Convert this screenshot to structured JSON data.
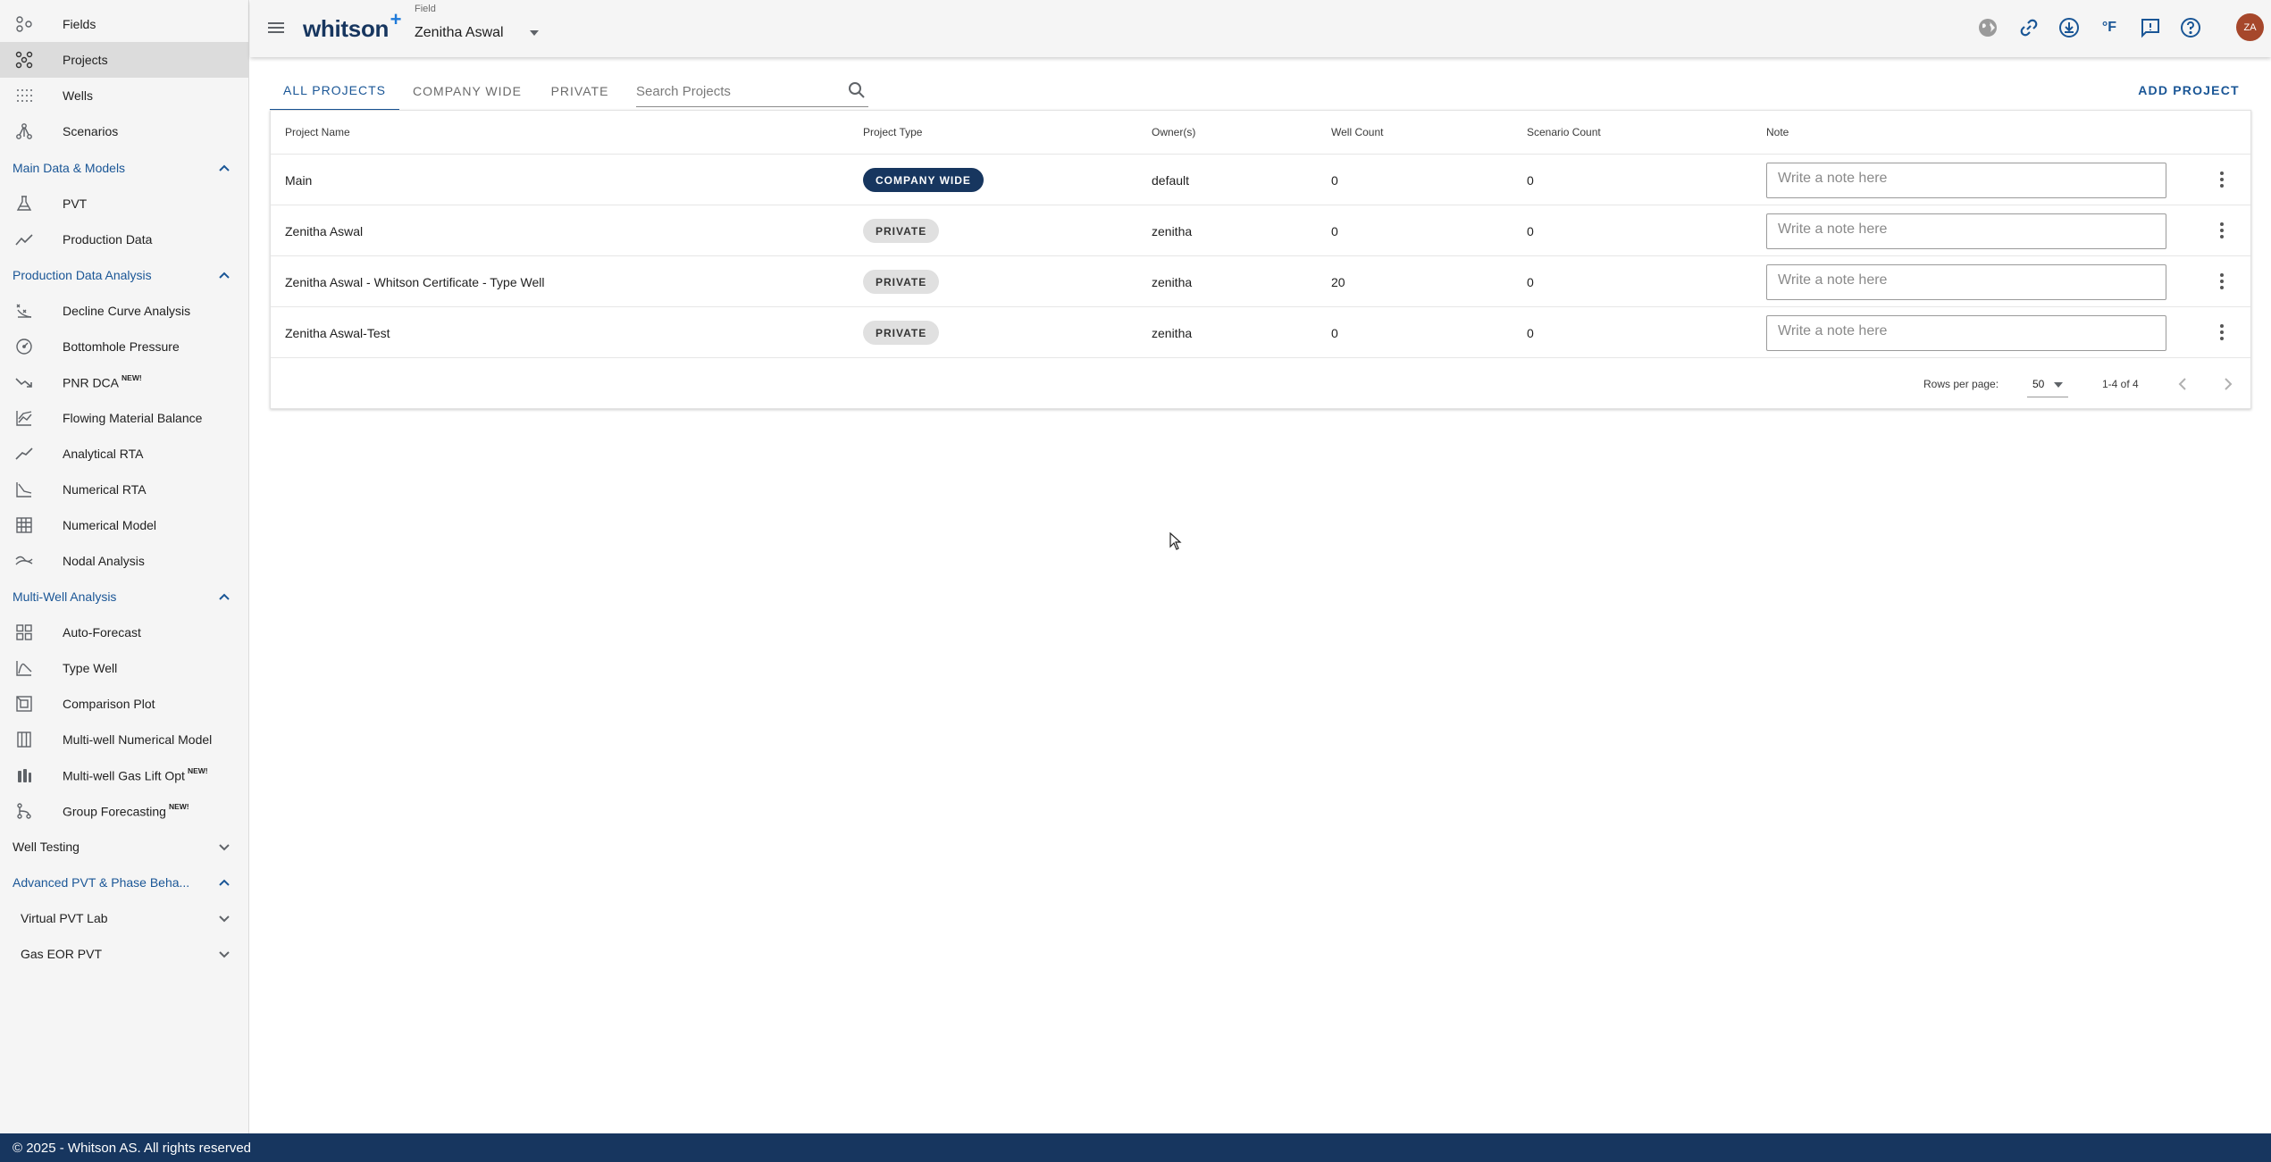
{
  "sidebar": {
    "top_items": [
      {
        "label": "Fields",
        "icon": "fields-icon"
      },
      {
        "label": "Projects",
        "icon": "projects-icon"
      },
      {
        "label": "Wells",
        "icon": "wells-icon"
      },
      {
        "label": "Scenarios",
        "icon": "scenarios-icon"
      }
    ],
    "sections": {
      "main_data": "Main Data & Models",
      "pda": "Production Data Analysis",
      "multi_well": "Multi-Well Analysis",
      "well_testing": "Well Testing",
      "advanced_pvt": "Advanced PVT & Phase Beha...",
      "virtual_pvt_lab": "Virtual PVT Lab",
      "gas_eor_pvt": "Gas EOR PVT"
    },
    "main_items": [
      {
        "label": "PVT"
      },
      {
        "label": "Production Data"
      }
    ],
    "pda_items": [
      {
        "label": "Decline Curve Analysis"
      },
      {
        "label": "Bottomhole Pressure"
      },
      {
        "label": "PNR DCA",
        "badge": "NEW!"
      },
      {
        "label": "Flowing Material Balance"
      },
      {
        "label": "Analytical RTA"
      },
      {
        "label": "Numerical RTA"
      },
      {
        "label": "Numerical Model"
      },
      {
        "label": "Nodal Analysis"
      }
    ],
    "mw_items": [
      {
        "label": "Auto-Forecast"
      },
      {
        "label": "Type Well"
      },
      {
        "label": "Comparison Plot"
      },
      {
        "label": "Multi-well Numerical Model"
      },
      {
        "label": "Multi-well Gas Lift Opt",
        "badge": "NEW!"
      },
      {
        "label": "Group Forecasting",
        "badge": "NEW!"
      }
    ]
  },
  "header": {
    "logo": "whitson",
    "logo_plus": "+",
    "field_caption": "Field",
    "field_name": "Zenitha Aswal",
    "avatar_initials": "ZA",
    "icons": [
      "globe-icon",
      "link-icon",
      "download-icon",
      "temperature-unit-icon",
      "feedback-icon",
      "help-icon"
    ],
    "temperature_unit": "°F"
  },
  "tabs": [
    {
      "label": "ALL PROJECTS",
      "active": true
    },
    {
      "label": "COMPANY WIDE",
      "active": false
    },
    {
      "label": "PRIVATE",
      "active": false
    }
  ],
  "search": {
    "placeholder": "Search Projects",
    "value": ""
  },
  "add_project_label": "ADD PROJECT",
  "table": {
    "columns": [
      "Project Name",
      "Project Type",
      "Owner(s)",
      "Well Count",
      "Scenario Count",
      "Note"
    ],
    "note_placeholder": "Write a note here",
    "rows": [
      {
        "name": "Main",
        "type": "COMPANY WIDE",
        "owner": "default",
        "well_count": "0",
        "scenario_count": "0"
      },
      {
        "name": "Zenitha Aswal",
        "type": "PRIVATE",
        "owner": "zenitha",
        "well_count": "0",
        "scenario_count": "0"
      },
      {
        "name": "Zenitha Aswal - Whitson Certificate - Type Well",
        "type": "PRIVATE",
        "owner": "zenitha",
        "well_count": "20",
        "scenario_count": "0"
      },
      {
        "name": "Zenitha Aswal-Test",
        "type": "PRIVATE",
        "owner": "zenitha",
        "well_count": "0",
        "scenario_count": "0"
      }
    ]
  },
  "pagination": {
    "rows_per_page_label": "Rows per page:",
    "rows_per_page": "50",
    "range": "1-4 of 4"
  },
  "footer": {
    "text": "© 2025 - Whitson AS. All rights reserved"
  },
  "colors": {
    "brand_dark": "#17365f",
    "accent_blue": "#1a5696",
    "avatar": "#a6472b",
    "sidebar_bg": "#f5f5f5"
  }
}
